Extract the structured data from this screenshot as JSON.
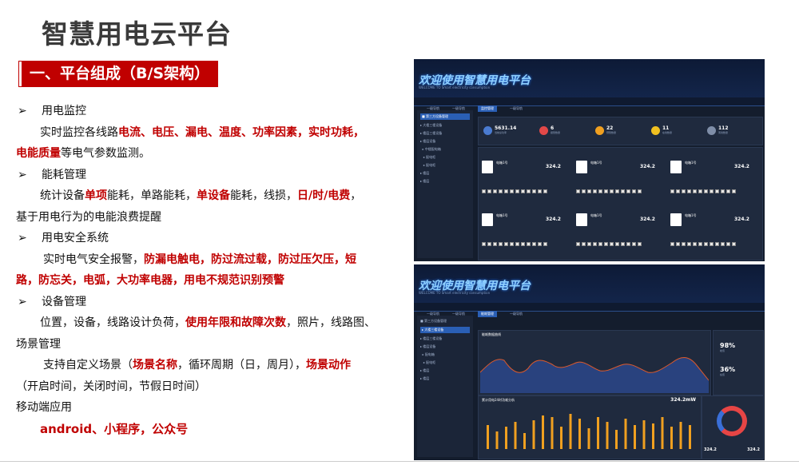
{
  "title": "智慧用电云平台",
  "banner": "一、平台组成（B/S架构）",
  "bullet_marker": "➢",
  "lines": [
    {
      "type": "bullet",
      "segs": [
        {
          "t": "用电监控",
          "red": false
        }
      ]
    },
    {
      "type": "indent",
      "segs": [
        {
          "t": "实时监控各线路",
          "red": false
        },
        {
          "t": "电流、电压、漏电、温度、功率因素，实时功耗，",
          "red": true
        }
      ]
    },
    {
      "type": "plain",
      "segs": [
        {
          "t": "电能质量",
          "red": true
        },
        {
          "t": "等电气参数监测。",
          "red": false
        }
      ]
    },
    {
      "type": "bullet",
      "segs": [
        {
          "t": "能耗管理",
          "red": false
        }
      ]
    },
    {
      "type": "indent",
      "segs": [
        {
          "t": "统计设备",
          "red": false
        },
        {
          "t": "单项",
          "red": true
        },
        {
          "t": "能耗，单路能耗，",
          "red": false
        },
        {
          "t": "单设备",
          "red": true
        },
        {
          "t": "能耗，线损，",
          "red": false
        },
        {
          "t": "日/时/电费",
          "red": true
        },
        {
          "t": "，",
          "red": false
        }
      ]
    },
    {
      "type": "plain",
      "segs": [
        {
          "t": "基于用电行为的电能浪费提醒",
          "red": false
        }
      ]
    },
    {
      "type": "bullet",
      "segs": [
        {
          "t": "用电安全系统",
          "red": false
        }
      ]
    },
    {
      "type": "indent2",
      "segs": [
        {
          "t": "实时电气安全报警，",
          "red": false
        },
        {
          "t": "防漏电触电，防过流过载，防过压欠压，短",
          "red": true
        }
      ]
    },
    {
      "type": "plain",
      "segs": [
        {
          "t": "路，防忘关，电弧，大功率电器，用电不规范识别预警",
          "red": true
        }
      ]
    },
    {
      "type": "bullet",
      "segs": [
        {
          "t": "设备管理",
          "red": false
        }
      ]
    },
    {
      "type": "indent",
      "segs": [
        {
          "t": "位置，设备，线路设计负荷，",
          "red": false
        },
        {
          "t": "使用年限和故障次数",
          "red": true
        },
        {
          "t": "，照片，线路图、",
          "red": false
        }
      ]
    },
    {
      "type": "plain",
      "segs": [
        {
          "t": "场景管理",
          "red": false
        }
      ]
    },
    {
      "type": "indent2",
      "segs": [
        {
          "t": "支持自定义场景（",
          "red": false
        },
        {
          "t": "场景名称",
          "red": true
        },
        {
          "t": "，循环周期（日，周月），",
          "red": false
        },
        {
          "t": "场景动作",
          "red": true
        }
      ]
    },
    {
      "type": "plain",
      "segs": [
        {
          "t": "（开启时间，关闭时间，节假日时间）",
          "red": false
        }
      ]
    },
    {
      "type": "plain",
      "segs": [
        {
          "t": "移动端应用",
          "red": false
        }
      ]
    },
    {
      "type": "indent",
      "segs": [
        {
          "t": "android、小程序，公众号",
          "red": true,
          "big": true
        }
      ]
    }
  ],
  "screenshot1": {
    "welcome": "欢迎使用智慧用电平台",
    "welcome_sub": "WELCOME TO Smart electricity consumption",
    "nav": [
      "一级导航",
      "一级导航",
      "监控管理",
      "一级导航"
    ],
    "nav_active": 2,
    "stats": [
      {
        "value": "5631.14",
        "label": "当前总功率",
        "color": "#4a7bd1"
      },
      {
        "value": "6",
        "label": "报警数量",
        "color": "#e24848"
      },
      {
        "value": "22",
        "label": "预警数量",
        "color": "#f0a020"
      },
      {
        "value": "11",
        "label": "在线数量",
        "color": "#f0c020"
      },
      {
        "value": "112",
        "label": "离线数量",
        "color": "#7f8ea8"
      }
    ],
    "card_title": "电箱1号",
    "card_value": "324.2"
  },
  "screenshot2": {
    "welcome": "欢迎使用智慧用电平台",
    "welcome_sub": "WELCOME TO Smart electricity consumption",
    "nav": [
      "一级导航",
      "一级导航",
      "能耗管理",
      "一级导航"
    ],
    "nav_active": 2,
    "chart_title": "能耗数据曲线",
    "bar_title": "累计用电24时功耗分析",
    "bar_value": "324.2mW",
    "pct1": {
      "value": "98%",
      "label": "峰值"
    },
    "pct2": {
      "value": "36%",
      "label": "谷值"
    },
    "donut_left": "324.2",
    "donut_right": "324.2"
  },
  "colors": {
    "accent": "#c00000",
    "screen_bg": "#141d2d",
    "bar": "#f0a020"
  }
}
